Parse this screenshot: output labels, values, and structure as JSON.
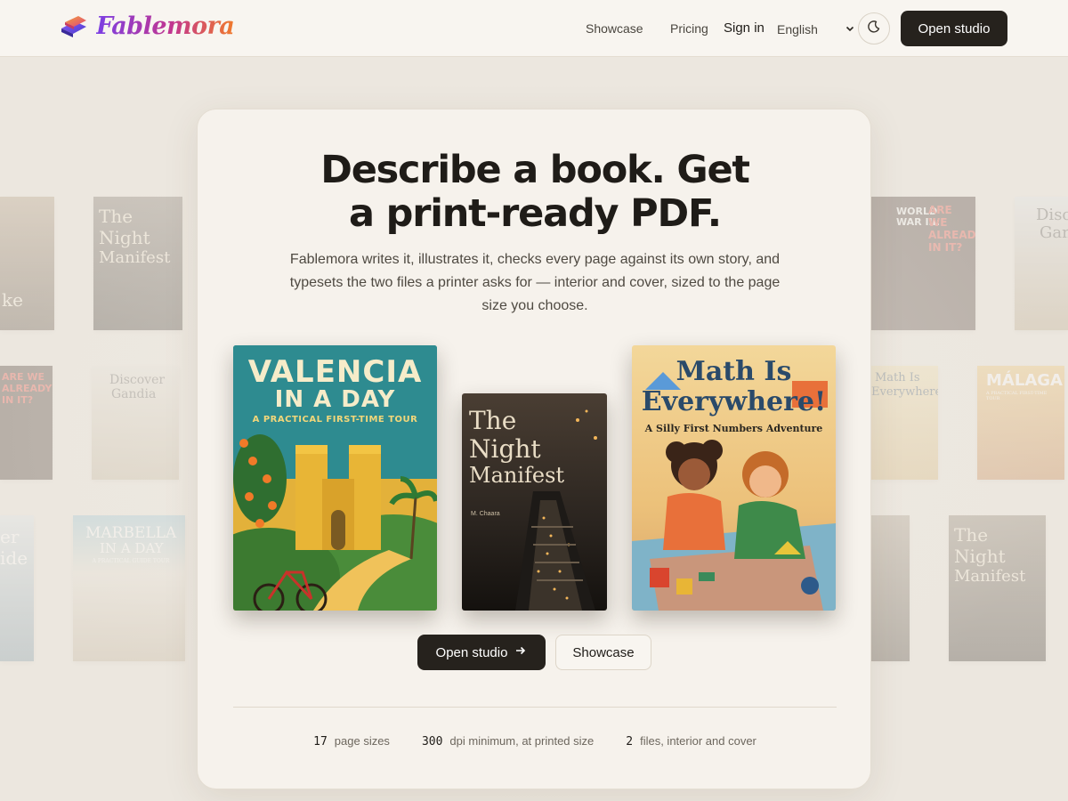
{
  "header": {
    "brand": "Fablemora",
    "nav": {
      "showcase": "Showcase",
      "pricing": "Pricing",
      "signin": "Sign in"
    },
    "language": "English",
    "open_studio": "Open studio"
  },
  "hero": {
    "title_line1": "Describe a book. Get",
    "title_line2": "a print-ready PDF.",
    "subtitle": "Fablemora writes it, illustrates it, checks every page against its own story, and typesets the two files a printer asks for — interior and cover, sized to the page size you choose."
  },
  "covers": [
    {
      "title_line1": "VALENCIA",
      "title_line2": "IN A DAY",
      "subtitle": "A PRACTICAL FIRST-TIME TOUR"
    },
    {
      "title_line1": "The",
      "title_line2": "Night",
      "title_line3": "Manifest",
      "author": "M. Chaara"
    },
    {
      "title_line1": "Math Is",
      "title_line2": "Everywhere!",
      "subtitle": "A Silly First Numbers Adventure"
    }
  ],
  "background_books": [
    {
      "title_line1": "The",
      "title_line2": "Night",
      "title_line3": "Manifest"
    },
    {
      "title_line1": "WORLD",
      "title_line2": "WAR III:",
      "title_line3": "ARE WE ALREADY IN IT?"
    },
    {
      "title_line1": "Discover",
      "title_line2": "Gandia"
    },
    {
      "title_line1": "Math Is",
      "title_line2": "Everywhere!"
    },
    {
      "title_line1": "MÁLAGA",
      "subtitle": "A PRACTICAL FIRST-TIME TOUR"
    },
    {
      "title_line1": "MARBELLA",
      "title_line2": "IN A DAY",
      "subtitle": "A PRACTICAL GUIDE TOUR"
    },
    {
      "title_line1": "er",
      "title_line2": "ide"
    },
    {
      "title_line1": "ke"
    }
  ],
  "actions": {
    "primary": "Open studio",
    "secondary": "Showcase"
  },
  "stats": [
    {
      "num": "17",
      "label": "page sizes"
    },
    {
      "num": "300",
      "label": "dpi minimum, at printed size"
    },
    {
      "num": "2",
      "label": "files, interior and cover"
    }
  ],
  "colors": {
    "accent_dark": "#26221d",
    "card_bg": "#f6f2ec",
    "brand_gradient_start": "#7b3fe4",
    "brand_gradient_end": "#f07a2c"
  }
}
